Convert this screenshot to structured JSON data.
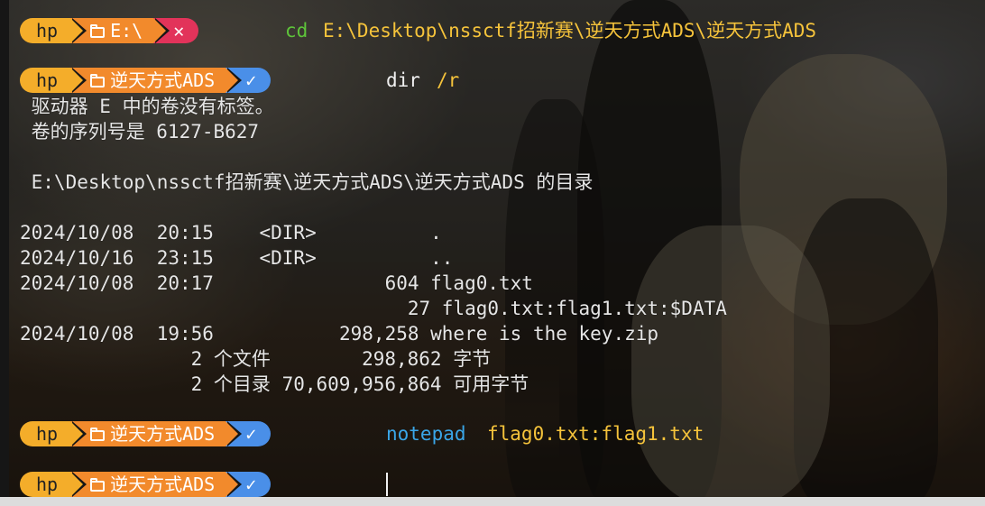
{
  "theme": {
    "user_color": "#f4ad2a",
    "path_color": "#f28a2c",
    "error_color": "#e2335a",
    "ok_color": "#4a8fe8",
    "command_color": "#5ec43a",
    "arg_color": "#f5c33b",
    "notepad_color": "#3aa6e8"
  },
  "prompts": [
    {
      "user": "hp",
      "path": "E:\\",
      "status_icon": "close-icon",
      "status_glyph": "✕",
      "command": "cd",
      "args": "E:\\Desktop\\nssctf招新赛\\逆天方式ADS\\逆天方式ADS"
    },
    {
      "user": "hp",
      "path": "逆天方式ADS",
      "status_icon": "check-icon",
      "status_glyph": "✓",
      "command": "dir",
      "args": "/r"
    },
    {
      "user": "hp",
      "path": "逆天方式ADS",
      "status_icon": "check-icon",
      "status_glyph": "✓",
      "command": "notepad",
      "args": "flag0.txt:flag1.txt"
    },
    {
      "user": "hp",
      "path": "逆天方式ADS",
      "status_icon": "check-icon",
      "status_glyph": "✓",
      "command": "",
      "args": ""
    }
  ],
  "dir_output": {
    "volume_line": " 驱动器 E 中的卷没有标签。",
    "serial_line": " 卷的序列号是 6127-B627",
    "directory_line": " E:\\Desktop\\nssctf招新赛\\逆天方式ADS\\逆天方式ADS 的目录",
    "entries": [
      "2024/10/08  20:15    <DIR>          .",
      "2024/10/16  23:15    <DIR>          ..",
      "2024/10/08  20:17               604 flag0.txt",
      "                                  27 flag0.txt:flag1.txt:$DATA",
      "2024/10/08  19:56           298,258 where is the key.zip"
    ],
    "summary_files": "               2 个文件        298,862 字节",
    "summary_dirs": "               2 个目录 70,609,956,864 可用字节"
  }
}
